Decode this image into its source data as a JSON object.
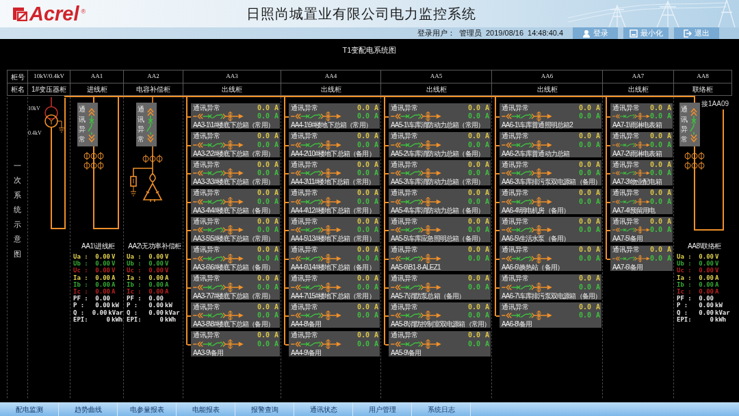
{
  "header": {
    "logo": "Acrel",
    "logo_mark": "®",
    "title": "日照尚城置业有限公司电力监控系统"
  },
  "login_bar": {
    "user_label": "登录用户：",
    "user": "管理员",
    "date": "2019/08/16",
    "time": "14:48:40.4",
    "buttons": [
      {
        "kind": "user",
        "label": "登录"
      },
      {
        "kind": "minimize",
        "label": "最小化"
      },
      {
        "kind": "exit",
        "label": "退出"
      }
    ]
  },
  "diagram_title": "T1变配电系统图",
  "cabinet_table": {
    "row_headers": [
      "柜号",
      "柜名"
    ],
    "columns": [
      {
        "number": "10kV/0.4kV",
        "name": "1#变压器柜"
      },
      {
        "number": "AA1",
        "name": "进线柜"
      },
      {
        "number": "AA2",
        "name": "电容补偿柜"
      },
      {
        "number": "AA3",
        "name": "出线柜"
      },
      {
        "number": "AA4",
        "name": "出线柜"
      },
      {
        "number": "AA5",
        "name": "出线柜"
      },
      {
        "number": "AA6",
        "name": "出线柜"
      },
      {
        "number": "AA7",
        "name": "出线柜"
      },
      {
        "number": "AA8",
        "name": "联络柜"
      }
    ]
  },
  "side_label": "一次系统示意图",
  "diagram_columns": [
    {
      "kind": "transformer",
      "primary": "10kV",
      "secondary": "0.4kV"
    },
    {
      "kind": "incoming",
      "status": "通讯异常",
      "meter": {
        "title": "AA1\\进线柜",
        "rows": [
          {
            "label": "Ua :",
            "value": "0.00",
            "unit": "V",
            "color": "#e0d050"
          },
          {
            "label": "Ub :",
            "value": "0.00",
            "unit": "V",
            "color": "#34a834"
          },
          {
            "label": "Uc :",
            "value": "0.00",
            "unit": "V",
            "color": "#b82020"
          },
          {
            "label": "Ia :",
            "value": "0.00",
            "unit": "A",
            "color": "#e0d050"
          },
          {
            "label": "Ib :",
            "value": "0.00",
            "unit": "A",
            "color": "#34a834"
          },
          {
            "label": "Ic :",
            "value": "0.00",
            "unit": "A",
            "color": "#b82020"
          },
          {
            "label": "PF :",
            "value": "0.00",
            "color": "#e6e6e6"
          },
          {
            "label": "P :",
            "value": "0.00",
            "unit": "kW",
            "color": "#e6e6e6"
          },
          {
            "label": "Q :",
            "value": "0.00",
            "unit": "kVar",
            "color": "#e6e6e6"
          },
          {
            "label": "EPI:",
            "value": "0",
            "unit": "kWh",
            "color": "#e6e6e6"
          }
        ]
      }
    },
    {
      "kind": "capacitor",
      "status": "通讯异常",
      "meter": {
        "title": "AA2\\无功率补偿柜",
        "rows": [
          {
            "label": "Ua :",
            "value": "0.00",
            "unit": "V",
            "color": "#e0d050"
          },
          {
            "label": "Ub :",
            "value": "0.00",
            "unit": "V",
            "color": "#34a834"
          },
          {
            "label": "Uc :",
            "value": "0.00",
            "unit": "V",
            "color": "#b82020"
          },
          {
            "label": "Ia :",
            "value": "0.00",
            "unit": "A",
            "color": "#e0d050"
          },
          {
            "label": "Ib :",
            "value": "0.00",
            "unit": "A",
            "color": "#34a834"
          },
          {
            "label": "Ic :",
            "value": "0.00",
            "unit": "A",
            "color": "#b82020"
          },
          {
            "label": "PF :",
            "value": "0.00",
            "color": "#e6e6e6"
          },
          {
            "label": "P :",
            "value": "0.00",
            "unit": "kW",
            "color": "#e6e6e6"
          },
          {
            "label": "Q :",
            "value": "0.00",
            "unit": "kVar",
            "color": "#e6e6e6"
          },
          {
            "label": "EPI:",
            "value": "0",
            "unit": "kWh",
            "color": "#e6e6e6"
          }
        ]
      }
    },
    {
      "kind": "feeders",
      "feeders": [
        {
          "status": "通讯异常",
          "readings": [
            {
              "value": "0.0",
              "unit": "A",
              "color": "#d9c447"
            },
            {
              "value": "0.0",
              "unit": "A",
              "color": "#3fbf3f"
            }
          ],
          "name": "AA3-1\\1#楼底下总箱（常用）"
        },
        {
          "status": "通讯异常",
          "readings": [
            {
              "value": "0.0",
              "unit": "A",
              "color": "#d9c447"
            },
            {
              "value": "0.0",
              "unit": "A",
              "color": "#3fbf3f"
            }
          ],
          "name": "AA3-2\\2#楼底下总箱（常用）"
        },
        {
          "status": "通讯异常",
          "readings": [
            {
              "value": "0.0",
              "unit": "A",
              "color": "#d9c447"
            },
            {
              "value": "0.0",
              "unit": "A",
              "color": "#3fbf3f"
            }
          ],
          "name": "AA3-3\\3#楼底下总箱（常用）"
        },
        {
          "status": "通讯异常",
          "readings": [
            {
              "value": "0.0",
              "unit": "A",
              "color": "#d9c447"
            },
            {
              "value": "0.0",
              "unit": "A",
              "color": "#3fbf3f"
            }
          ],
          "name": "AA3-4\\4#楼底下总箱（备用）"
        },
        {
          "status": "通讯异常",
          "readings": [
            {
              "value": "0.0",
              "unit": "A",
              "color": "#d9c447"
            },
            {
              "value": "0.0",
              "unit": "A",
              "color": "#3fbf3f"
            }
          ],
          "name": "AA3-5\\5#楼底下总箱（常用）"
        },
        {
          "status": "通讯异常",
          "readings": [
            {
              "value": "0.0",
              "unit": "A",
              "color": "#d9c447"
            },
            {
              "value": "0.0",
              "unit": "A",
              "color": "#3fbf3f"
            }
          ],
          "name": "AA3-6\\6#楼底下总箱（备用）"
        },
        {
          "status": "通讯异常",
          "readings": [
            {
              "value": "0.0",
              "unit": "A",
              "color": "#d9c447"
            },
            {
              "value": "0.0",
              "unit": "A",
              "color": "#3fbf3f"
            }
          ],
          "name": "AA3-7\\7#楼底下总箱（常用）"
        },
        {
          "status": "通讯异常",
          "readings": [
            {
              "value": "0.0",
              "unit": "A",
              "color": "#d9c447"
            },
            {
              "value": "0.0",
              "unit": "A",
              "color": "#3fbf3f"
            }
          ],
          "name": "AA3-8\\8#楼底下总箱（备用）"
        },
        {
          "status": "通讯异常",
          "readings": [
            {
              "value": "0.0",
              "unit": "A",
              "color": "#d9c447"
            },
            {
              "value": "0.0",
              "unit": "A",
              "color": "#3fbf3f"
            }
          ],
          "name": "AA3-9\\备用"
        }
      ]
    },
    {
      "kind": "feeders",
      "feeders": [
        {
          "status": "通讯异常",
          "readings": [
            {
              "value": "0.0",
              "unit": "A",
              "color": "#d9c447"
            },
            {
              "value": "0.0",
              "unit": "A",
              "color": "#3fbf3f"
            }
          ],
          "name": "AA4-1\\9#楼地下总箱（常用）"
        },
        {
          "status": "通讯异常",
          "readings": [
            {
              "value": "0.0",
              "unit": "A",
              "color": "#d9c447"
            },
            {
              "value": "0.0",
              "unit": "A",
              "color": "#3fbf3f"
            }
          ],
          "name": "AA4-2\\10#楼地下总箱（备用）"
        },
        {
          "status": "通讯异常",
          "readings": [
            {
              "value": "0.0",
              "unit": "A",
              "color": "#d9c447"
            },
            {
              "value": "0.0",
              "unit": "A",
              "color": "#3fbf3f"
            }
          ],
          "name": "AA4-3\\11#楼地下总箱（常用）"
        },
        {
          "status": "通讯异常",
          "readings": [
            {
              "value": "0.0",
              "unit": "A",
              "color": "#d9c447"
            },
            {
              "value": "0.0",
              "unit": "A",
              "color": "#3fbf3f"
            }
          ],
          "name": "AA4-4\\12#楼地下总箱（常用）"
        },
        {
          "status": "通讯异常",
          "readings": [
            {
              "value": "0.0",
              "unit": "A",
              "color": "#d9c447"
            },
            {
              "value": "0.0",
              "unit": "A",
              "color": "#3fbf3f"
            }
          ],
          "name": "AA4-5\\13#楼地下总箱（常用）"
        },
        {
          "status": "通讯异常",
          "readings": [
            {
              "value": "0.0",
              "unit": "A",
              "color": "#d9c447"
            },
            {
              "value": "0.0",
              "unit": "A",
              "color": "#3fbf3f"
            }
          ],
          "name": "AA4-6\\14#楼地下总箱（备用）"
        },
        {
          "status": "通讯异常",
          "readings": [
            {
              "value": "0.0",
              "unit": "A",
              "color": "#d9c447"
            },
            {
              "value": "0.0",
              "unit": "A",
              "color": "#3fbf3f"
            }
          ],
          "name": "AA4-7\\15#楼地下总箱（常用）"
        },
        {
          "status": "通讯异常",
          "readings": [
            {
              "value": "0.0",
              "unit": "A",
              "color": "#d9c447"
            },
            {
              "value": "0.0",
              "unit": "A",
              "color": "#3fbf3f"
            }
          ],
          "name": "AA4-8\\备用"
        },
        {
          "status": "通讯异常",
          "readings": [
            {
              "value": "0.0",
              "unit": "A",
              "color": "#d9c447"
            },
            {
              "value": "0.0",
              "unit": "A",
              "color": "#3fbf3f"
            }
          ],
          "name": "AA4-9\\备用"
        }
      ]
    },
    {
      "kind": "feeders",
      "feeders": [
        {
          "status": "通讯异常",
          "readings": [
            {
              "value": "0.0",
              "unit": "A",
              "color": "#d9c447"
            },
            {
              "value": "0.0",
              "unit": "A",
              "color": "#3fbf3f"
            }
          ],
          "name": "AA5-1\\车库消防动力总箱（常用）"
        },
        {
          "status": "通讯异常",
          "readings": [
            {
              "value": "0.0",
              "unit": "A",
              "color": "#d9c447"
            },
            {
              "value": "0.0",
              "unit": "A",
              "color": "#3fbf3f"
            }
          ],
          "name": "AA5-2\\车库消防动力总箱（备用）"
        },
        {
          "status": "通讯异常",
          "readings": [
            {
              "value": "0.0",
              "unit": "A",
              "color": "#d9c447"
            },
            {
              "value": "0.0",
              "unit": "A",
              "color": "#3fbf3f"
            }
          ],
          "name": "AA5-3\\车库消防动力总箱（常用）"
        },
        {
          "status": "通讯异常",
          "readings": [
            {
              "value": "0.0",
              "unit": "A",
              "color": "#d9c447"
            },
            {
              "value": "0.0",
              "unit": "A",
              "color": "#3fbf3f"
            }
          ],
          "name": "AA5-4\\车库消防动力总箱（备用）"
        },
        {
          "status": "通讯异常",
          "readings": [
            {
              "value": "0.0",
              "unit": "A",
              "color": "#d9c447"
            },
            {
              "value": "0.0",
              "unit": "A",
              "color": "#3fbf3f"
            }
          ],
          "name": "AA5-5\\车库应急照明总箱（备用）"
        },
        {
          "status": "通讯异常",
          "readings": [
            {
              "value": "0.0",
              "unit": "A",
              "color": "#d9c447"
            },
            {
              "value": "0.0",
              "unit": "A",
              "color": "#3fbf3f"
            }
          ],
          "name": "AA5-6\\B1-8-ALEZ1"
        },
        {
          "status": "通讯异常",
          "readings": [
            {
              "value": "0.0",
              "unit": "A",
              "color": "#d9c447"
            },
            {
              "value": "0.0",
              "unit": "A",
              "color": "#3fbf3f"
            }
          ],
          "name": "AA5-7\\消防泵总箱（备用）"
        },
        {
          "status": "通讯异常",
          "readings": [
            {
              "value": "0.0",
              "unit": "A",
              "color": "#d9c447"
            },
            {
              "value": "0.0",
              "unit": "A",
              "color": "#3fbf3f"
            }
          ],
          "name": "AA5-8\\消防控制室双电源箱（常用）"
        },
        {
          "status": "通讯异常",
          "readings": [
            {
              "value": "0.0",
              "unit": "A",
              "color": "#d9c447"
            },
            {
              "value": "0.0",
              "unit": "A",
              "color": "#3fbf3f"
            }
          ],
          "name": "AA5-9\\备用"
        }
      ]
    },
    {
      "kind": "feeders",
      "feeders": [
        {
          "status": "通讯异常",
          "readings": [
            {
              "value": "0.0",
              "unit": "A",
              "color": "#d9c447"
            },
            {
              "value": "0.0",
              "unit": "A",
              "color": "#3fbf3f"
            }
          ],
          "name": "AA6-1\\车库普通照明总箱2"
        },
        {
          "status": "通讯异常",
          "readings": [
            {
              "value": "0.0",
              "unit": "A",
              "color": "#d9c447"
            },
            {
              "value": "0.0",
              "unit": "A",
              "color": "#3fbf3f"
            }
          ],
          "name": "AA6-2\\车库普通动力总箱"
        },
        {
          "status": "通讯异常",
          "readings": [
            {
              "value": "0.0",
              "unit": "A",
              "color": "#d9c447"
            },
            {
              "value": "0.0",
              "unit": "A",
              "color": "#3fbf3f"
            }
          ],
          "name": "AA6-3\\车库排污泵双电源箱（备用）"
        },
        {
          "status": "通讯异常",
          "readings": [
            {
              "value": "0.0",
              "unit": "A",
              "color": "#d9c447"
            },
            {
              "value": "0.0",
              "unit": "A",
              "color": "#3fbf3f"
            }
          ],
          "name": "AA6-4\\弱电机房（备用）"
        },
        {
          "status": "通讯异常",
          "readings": [
            {
              "value": "0.0",
              "unit": "A",
              "color": "#d9c447"
            },
            {
              "value": "0.0",
              "unit": "A",
              "color": "#3fbf3f"
            }
          ],
          "name": "AA6-5\\生活水泵（备用）"
        },
        {
          "status": "通讯异常",
          "readings": [
            {
              "value": "0.0",
              "unit": "A",
              "color": "#d9c447"
            },
            {
              "value": "0.0",
              "unit": "A",
              "color": "#3fbf3f"
            }
          ],
          "name": "AA6-6\\换热站（备用）"
        },
        {
          "status": "通讯异常",
          "readings": [
            {
              "value": "0.0",
              "unit": "A",
              "color": "#d9c447"
            },
            {
              "value": "0.0",
              "unit": "A",
              "color": "#3fbf3f"
            }
          ],
          "name": "AA6-7\\车库排污泵双电源箱（备用）"
        },
        {
          "status": "通讯异常",
          "readings": [
            {
              "value": "0.0",
              "unit": "A",
              "color": "#d9c447"
            },
            {
              "value": "0.0",
              "unit": "A",
              "color": "#3fbf3f"
            }
          ],
          "name": "AA6-8\\备用"
        }
      ]
    },
    {
      "kind": "feeders",
      "feeders": [
        {
          "status": "通讯异常",
          "readings": [
            {
              "value": "0.0",
              "unit": "A",
              "color": "#d9c447"
            },
            {
              "value": "0.0",
              "unit": "A",
              "color": "#3fbf3f"
            }
          ],
          "name": "AA7-1\\雨淋电表箱"
        },
        {
          "status": "通讯异常",
          "readings": [
            {
              "value": "0.0",
              "unit": "A",
              "color": "#d9c447"
            },
            {
              "value": "0.0",
              "unit": "A",
              "color": "#3fbf3f"
            }
          ],
          "name": "AA7-2\\雨淋电表箱"
        },
        {
          "status": "通讯异常",
          "readings": [
            {
              "value": "0.0",
              "unit": "A",
              "color": "#d9c447"
            },
            {
              "value": "0.0",
              "unit": "A",
              "color": "#3fbf3f"
            }
          ],
          "name": "AA7-3\\物业配电箱"
        },
        {
          "status": "通讯异常",
          "readings": [
            {
              "value": "0.0",
              "unit": "A",
              "color": "#d9c447"
            },
            {
              "value": "0.0",
              "unit": "A",
              "color": "#3fbf3f"
            }
          ],
          "name": "AA7-4\\预留用电"
        },
        {
          "status": "通讯异常",
          "readings": [
            {
              "value": "0.0",
              "unit": "A",
              "color": "#d9c447"
            },
            {
              "value": "0.0",
              "unit": "A",
              "color": "#3fbf3f"
            }
          ],
          "name": "AA7-5\\备用"
        },
        {
          "status": "通讯异常",
          "readings": [
            {
              "value": "0.0",
              "unit": "A",
              "color": "#d9c447"
            },
            {
              "value": "0.0",
              "unit": "A",
              "color": "#3fbf3f"
            }
          ],
          "name": "AA7-6\\备用"
        }
      ]
    },
    {
      "kind": "tie",
      "status": "通讯异常",
      "tag": "接1AA09",
      "meter": {
        "title": "AA8\\联络柜",
        "rows": [
          {
            "label": "Ua :",
            "value": "0.00",
            "unit": "V",
            "color": "#e0d050"
          },
          {
            "label": "Ub :",
            "value": "0.00",
            "unit": "V",
            "color": "#34a834"
          },
          {
            "label": "Uc :",
            "value": "0.00",
            "unit": "V",
            "color": "#b82020"
          },
          {
            "label": "Ia :",
            "value": "0.00",
            "unit": "A",
            "color": "#e0d050"
          },
          {
            "label": "Ib :",
            "value": "0.00",
            "unit": "A",
            "color": "#34a834"
          },
          {
            "label": "Ic :",
            "value": "0.00",
            "unit": "A",
            "color": "#b82020"
          },
          {
            "label": "PF :",
            "value": "0.00",
            "color": "#e6e6e6"
          },
          {
            "label": "P :",
            "value": "0.00",
            "unit": "kW",
            "color": "#e6e6e6"
          },
          {
            "label": "Q :",
            "value": "0.00",
            "unit": "kVar",
            "color": "#e6e6e6"
          },
          {
            "label": "EPI:",
            "value": "0",
            "unit": "kWh",
            "color": "#e6e6e6"
          }
        ]
      }
    }
  ],
  "nav_tabs": [
    {
      "label": "配电监测"
    },
    {
      "label": "趋势曲线"
    },
    {
      "label": "电参量报表"
    },
    {
      "label": "电能报表"
    },
    {
      "label": "报警查询"
    },
    {
      "label": "通讯状态"
    },
    {
      "label": "用户管理"
    },
    {
      "label": "系统日志"
    }
  ]
}
